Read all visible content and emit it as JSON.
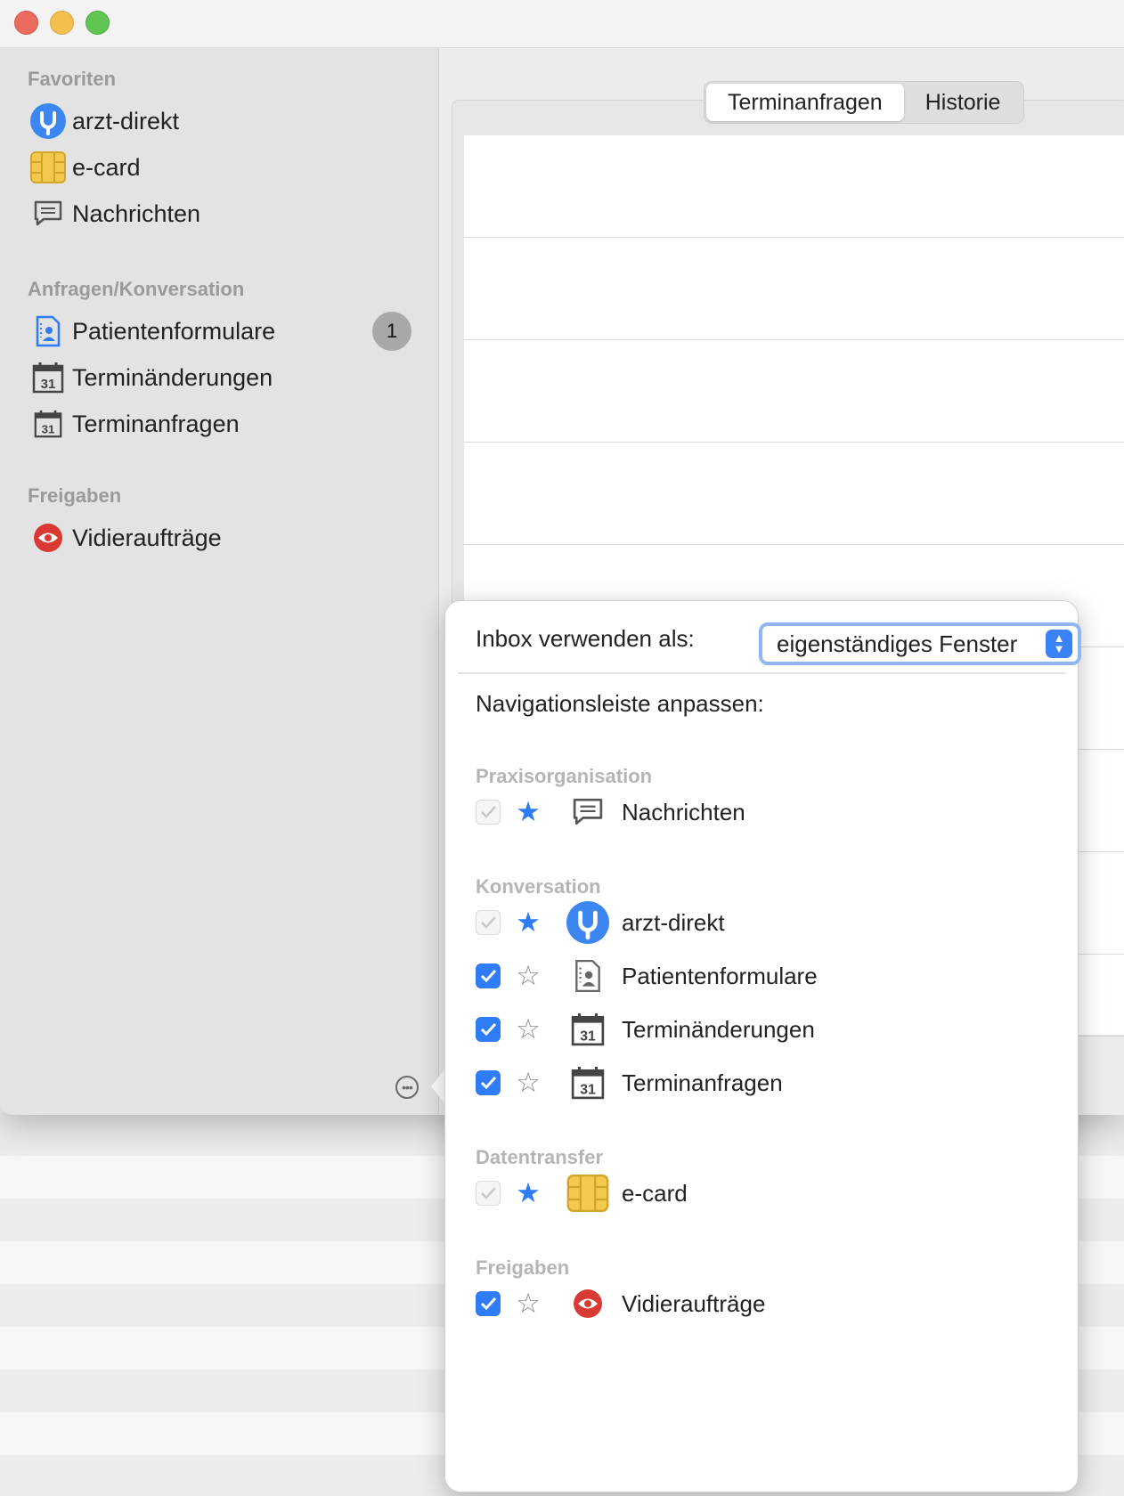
{
  "sidebar": {
    "sections": [
      {
        "title": "Favoriten",
        "items": [
          {
            "label": "arzt-direkt",
            "icon": "arzt-direkt-icon"
          },
          {
            "label": "e-card",
            "icon": "ecard-chip-icon"
          },
          {
            "label": "Nachrichten",
            "icon": "message-icon"
          }
        ]
      },
      {
        "title": "Anfragen/Konversation",
        "items": [
          {
            "label": "Patientenformulare",
            "icon": "patient-form-icon",
            "badge": "1"
          },
          {
            "label": "Terminänderungen",
            "icon": "calendar-icon"
          },
          {
            "label": "Terminanfragen",
            "icon": "calendar-icon"
          }
        ]
      },
      {
        "title": "Freigaben",
        "items": [
          {
            "label": "Vidieraufträge",
            "icon": "eye-icon"
          }
        ]
      }
    ],
    "more_icon": "more-icon"
  },
  "tabs": {
    "items": [
      "Terminanfragen",
      "Historie"
    ],
    "active": "Terminanfragen"
  },
  "popover": {
    "inbox_label": "Inbox verwenden als:",
    "inbox_value": "eigenständiges Fenster",
    "nav_label": "Navigationsleiste anpassen:",
    "sections": [
      {
        "title": "Praxisorganisation",
        "items": [
          {
            "label": "Nachrichten",
            "checked": true,
            "disabled": true,
            "favorite": true,
            "icon": "message-icon"
          }
        ]
      },
      {
        "title": "Konversation",
        "items": [
          {
            "label": "arzt-direkt",
            "checked": true,
            "disabled": true,
            "favorite": true,
            "icon": "arzt-direkt-icon"
          },
          {
            "label": "Patientenformulare",
            "checked": true,
            "disabled": false,
            "favorite": false,
            "icon": "patient-form-icon"
          },
          {
            "label": "Terminänderungen",
            "checked": true,
            "disabled": false,
            "favorite": false,
            "icon": "calendar-icon"
          },
          {
            "label": "Terminanfragen",
            "checked": true,
            "disabled": false,
            "favorite": false,
            "icon": "calendar-icon"
          }
        ]
      },
      {
        "title": "Datentransfer",
        "items": [
          {
            "label": "e-card",
            "checked": true,
            "disabled": true,
            "favorite": true,
            "icon": "ecard-chip-icon"
          }
        ]
      },
      {
        "title": "Freigaben",
        "items": [
          {
            "label": "Vidieraufträge",
            "checked": true,
            "disabled": false,
            "favorite": false,
            "icon": "eye-icon"
          }
        ]
      }
    ]
  },
  "calendar_day": "31",
  "colors": {
    "accent": "#2f7df6",
    "eye": "#d93a34",
    "chip": "#f2c94c"
  }
}
